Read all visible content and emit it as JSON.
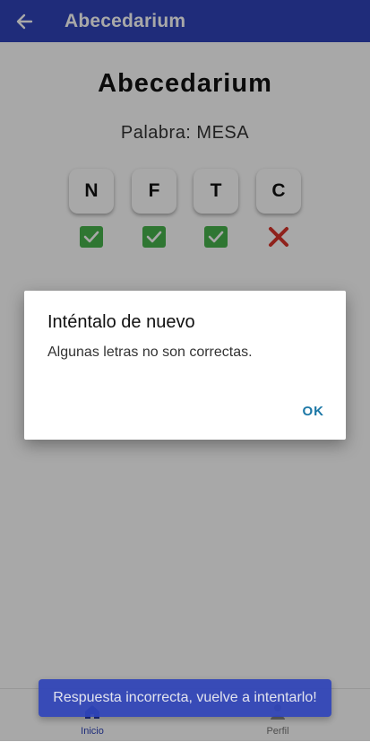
{
  "app_bar": {
    "title": "Abecedarium",
    "back_icon": "arrow-left-icon",
    "color": "#2f44b9"
  },
  "game": {
    "heading": "Abecedarium",
    "word_prompt": "Palabra: MESA",
    "letters": [
      "N",
      "F",
      "T",
      "C"
    ],
    "marks": [
      "correct",
      "correct",
      "correct",
      "incorrect"
    ],
    "mark_icons": [
      "check-icon",
      "check-icon",
      "check-icon",
      "cross-icon"
    ]
  },
  "dialog": {
    "title": "Inténtalo de nuevo",
    "message": "Algunas letras no son correctas.",
    "ok_label": "OK"
  },
  "snackbar": {
    "message": "Respuesta incorrecta, vuelve a intentarlo!"
  },
  "bottom_nav": {
    "items": [
      {
        "label": "Inicio",
        "icon": "home-icon",
        "active": true
      },
      {
        "label": "Perfil",
        "icon": "person-icon",
        "active": false
      }
    ]
  },
  "colors": {
    "primary": "#2f44b9",
    "correct": "#48b44d",
    "incorrect": "#d9342b",
    "dialog_button": "#1b77a6"
  }
}
